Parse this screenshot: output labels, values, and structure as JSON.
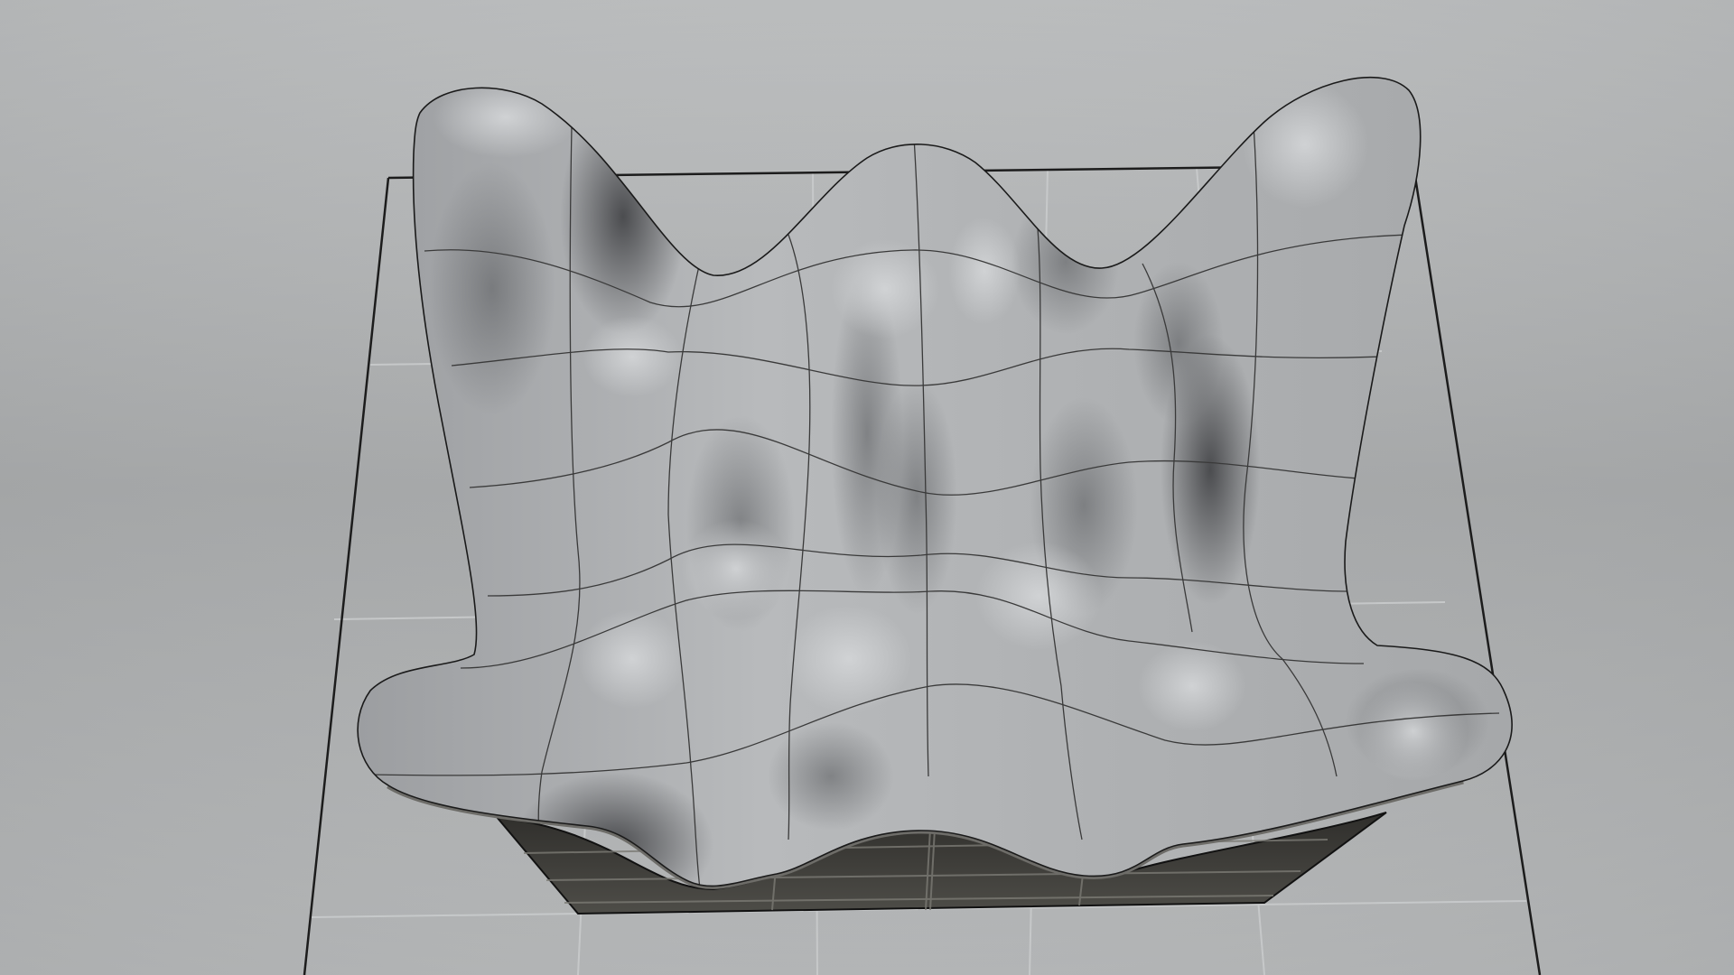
{
  "viewport": {
    "background_top": "#c6c8c9",
    "background_mid": "#a6a8a9",
    "background_bottom": "#b9bbbc",
    "grid_color": "#c9cbcc",
    "frame_color": "#1c1c1c"
  },
  "surface": {
    "base_color": "#b4b6b8",
    "highlight_color": "#ced0d2",
    "shadow_color": "#3e3f42",
    "isocurve_color": "#3a3a3a",
    "outline_color": "#1a1a1a"
  },
  "underside": {
    "fill_color": "#4b4a45",
    "rim_color": "#6d6c68",
    "line_color": "#111111"
  }
}
